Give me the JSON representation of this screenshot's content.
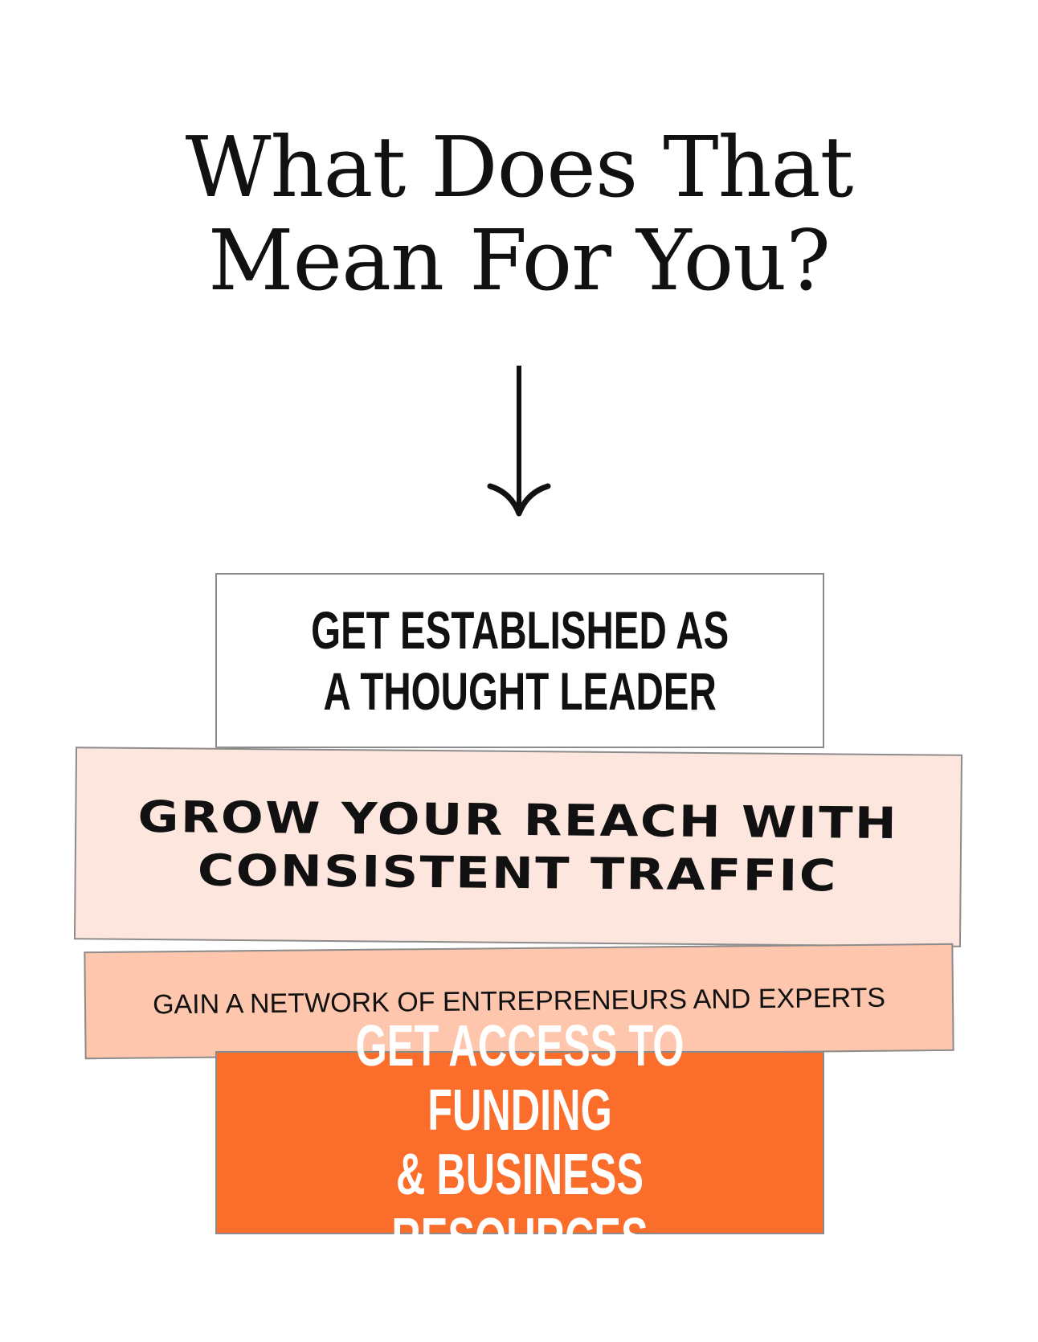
{
  "headline": {
    "line1": "What Does That",
    "line2": "Mean For You?"
  },
  "icons": {
    "arrow": "arrow-down-icon"
  },
  "cards": [
    {
      "line1": "GET ESTABLISHED AS",
      "line2": "A THOUGHT LEADER",
      "background": "#ffffff",
      "text_color": "#111111"
    },
    {
      "line1": "GROW YOUR REACH WITH",
      "line2": "CONSISTENT TRAFFIC",
      "background": "#fde6de",
      "text_color": "#111111"
    },
    {
      "line1": "GAIN A NETWORK OF ENTREPRENEURS AND EXPERTS",
      "background": "#fdc6ad",
      "text_color": "#111111"
    },
    {
      "line1": "GET ACCESS TO FUNDING",
      "line2": "& BUSINESS RESOURCES",
      "background": "#fb6d2a",
      "text_color": "#ffffff"
    }
  ]
}
